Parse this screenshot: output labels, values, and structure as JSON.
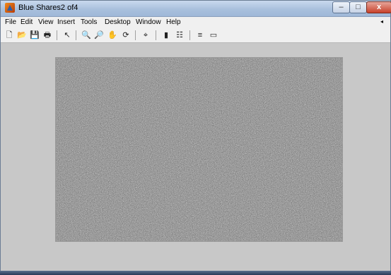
{
  "window": {
    "title": "Blue Shares2 of4",
    "controls": {
      "minimize": "–",
      "maximize": "□",
      "close": "x"
    }
  },
  "menubar": {
    "items": [
      "File",
      "Edit",
      "View",
      "Insert",
      "Tools",
      "Desktop",
      "Window",
      "Help"
    ],
    "overflow_arrow": "◂"
  },
  "toolbar": {
    "icons": [
      {
        "name": "new-figure-icon",
        "glyph": "🗋"
      },
      {
        "name": "open-file-icon",
        "glyph": "📂"
      },
      {
        "name": "save-icon",
        "glyph": "💾"
      },
      {
        "name": "print-icon",
        "glyph": "🖶"
      },
      {
        "name": "select-arrow-icon",
        "glyph": "↖"
      },
      {
        "name": "zoom-in-icon",
        "glyph": "🔍"
      },
      {
        "name": "zoom-out-icon",
        "glyph": "🔎"
      },
      {
        "name": "pan-icon",
        "glyph": "✋"
      },
      {
        "name": "rotate-icon",
        "glyph": "⟳"
      },
      {
        "name": "data-cursor-icon",
        "glyph": "⌖"
      },
      {
        "name": "colorbar-icon",
        "glyph": "▮"
      },
      {
        "name": "legend-icon",
        "glyph": "☷"
      },
      {
        "name": "hide-plot-tools-icon",
        "glyph": "≡"
      },
      {
        "name": "show-plot-tools-icon",
        "glyph": "▭"
      }
    ]
  },
  "figure": {
    "content": "noise-image",
    "background_color": "#c8c8c8"
  }
}
